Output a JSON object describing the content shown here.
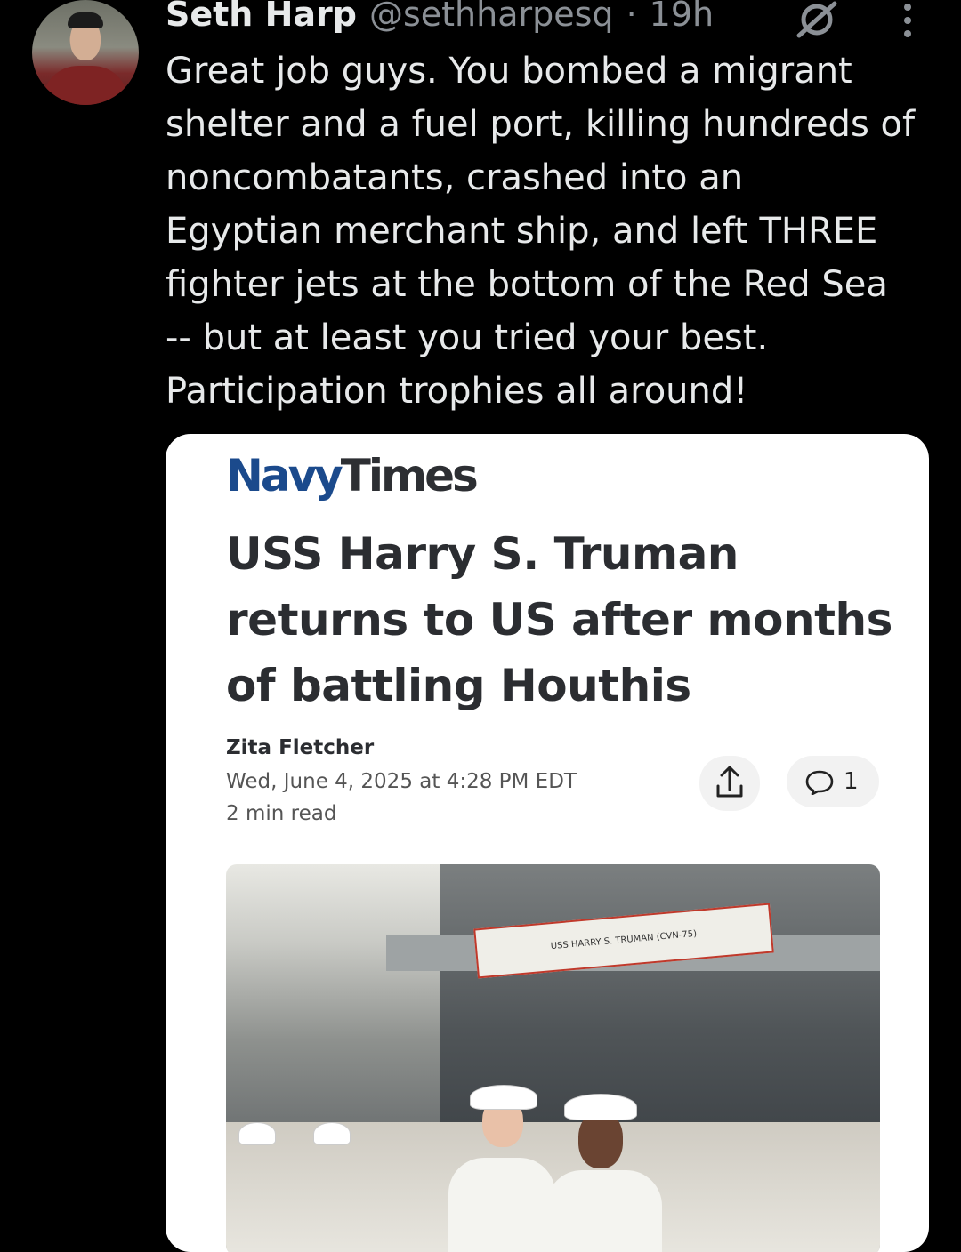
{
  "tweet": {
    "display_name": "Seth Harp",
    "handle": "@sethharpesq",
    "separator": "·",
    "time": "19h",
    "text": "Great job guys. You bombed a migrant\nshelter and a fuel port, killing hundreds of\nnoncombatants, crashed into an\nEgyptian merchant ship, and left THREE\nfighter jets at the bottom of the Red Sea\n-- but at least you tried your best.\nParticipation trophies all around!"
  },
  "card": {
    "logo_navy": "Navy",
    "logo_times": "Times",
    "headline": "USS Harry S. Truman returns to US after months of battling Houthis",
    "author": "Zita Fletcher",
    "date": "Wed, June 4, 2025 at 4:28 PM EDT",
    "read_time": "2 min read",
    "comment_count": "1",
    "photo_banner": "USS HARRY S. TRUMAN (CVN-75)"
  },
  "icons": {
    "grok": "grok-icon",
    "more": "more-icon",
    "share": "share-icon",
    "comment": "comment-icon"
  },
  "colors": {
    "background": "#000000",
    "text": "#e7e9ea",
    "muted": "#8b9096",
    "logo_blue": "#1b4a8c"
  }
}
